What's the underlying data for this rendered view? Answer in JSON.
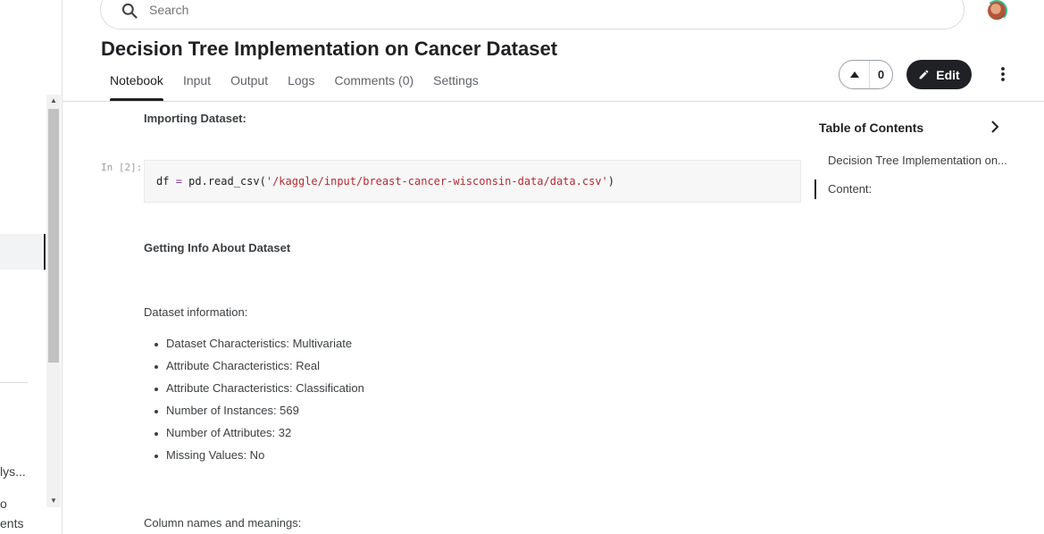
{
  "sidebar": {
    "items": [
      {
        "label": "lys..."
      },
      {
        "label": "o"
      },
      {
        "label": "ents"
      }
    ]
  },
  "search": {
    "placeholder": "Search"
  },
  "page": {
    "title": "Decision Tree Implementation on Cancer Dataset"
  },
  "tabs": [
    {
      "label": "Notebook"
    },
    {
      "label": "Input"
    },
    {
      "label": "Output"
    },
    {
      "label": "Logs"
    },
    {
      "label": "Comments (0)"
    },
    {
      "label": "Settings"
    }
  ],
  "vote": {
    "count": "0"
  },
  "edit": {
    "label": "Edit"
  },
  "toc": {
    "title": "Table of Contents",
    "items": [
      {
        "label": "Decision Tree Implementation on..."
      },
      {
        "label": "Content:"
      }
    ]
  },
  "notebook": {
    "heading_importing": "Importing Dataset:",
    "cell_prompt": "In [2]:",
    "code": {
      "part1": "df ",
      "op": "=",
      "part2": " pd.read_csv(",
      "string": "'/kaggle/input/breast-cancer-wisconsin-data/data.csv'",
      "part3": ")"
    },
    "heading_info": "Getting Info About Dataset",
    "dataset_info_label": "Dataset information:",
    "info_items": [
      "Dataset Characteristics: Multivariate",
      "Attribute Characteristics: Real",
      "Attribute Characteristics: Classification",
      "Number of Instances: 569",
      "Number of Attributes: 32",
      "Missing Values: No"
    ],
    "column_names_label": "Column names and meanings:"
  },
  "colors": {
    "primary_dark": "#202124",
    "code_string": "#b22b31",
    "border": "#dadce0"
  }
}
